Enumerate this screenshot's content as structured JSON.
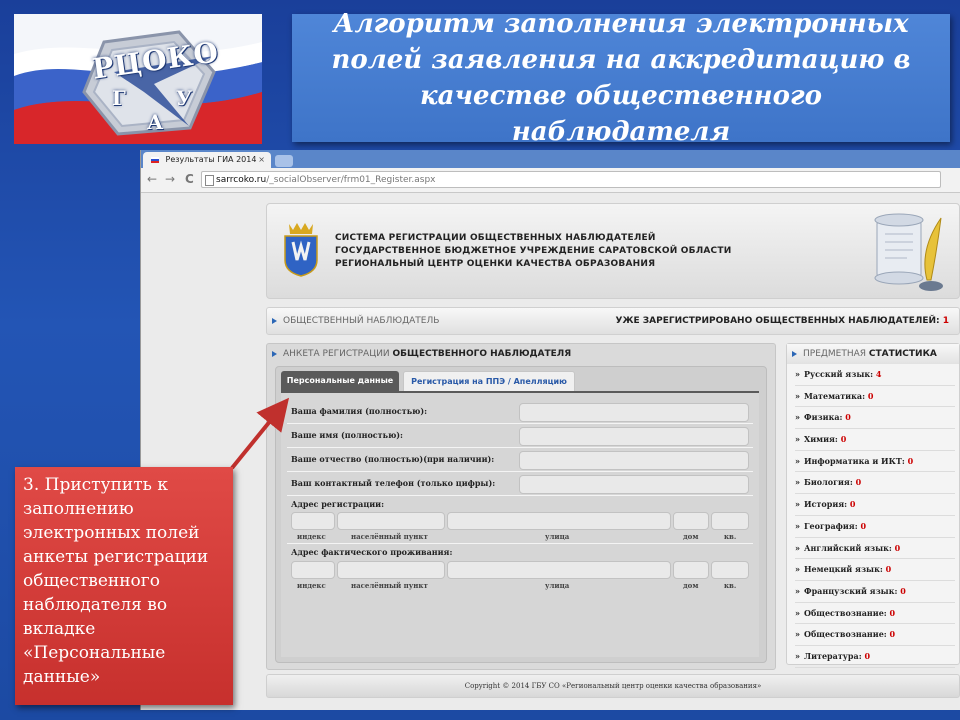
{
  "logo": {
    "main_text": "РЦОКО",
    "letters": [
      "Г",
      "У",
      "А"
    ]
  },
  "slide_title": "Алгоритм заполнения электронных полей заявления на аккредитацию в качестве общественного наблюдателя",
  "browser": {
    "tab_title": "Результаты ГИА 2014",
    "tab_close": "×",
    "url_host": "sarrcoko.ru",
    "url_path": "/_socialObserver/frm01_Register.aspx",
    "nav": {
      "back": "←",
      "forward": "→",
      "reload": "C"
    }
  },
  "site": {
    "header_lines": [
      "СИСТЕМА РЕГИСТРАЦИИ ОБЩЕСТВЕННЫХ НАБЛЮДАТЕЛЕЙ",
      "ГОСУДАРСТВЕННОЕ БЮДЖЕТНОЕ УЧРЕЖДЕНИЕ САРАТОВСКОЙ ОБЛАСТИ",
      "РЕГИОНАЛЬНЫЙ ЦЕНТР ОЦЕНКИ КАЧЕСТВА ОБРАЗОВАНИЯ"
    ],
    "bar_left": "ОБЩЕСТВЕННЫЙ НАБЛЮДАТЕЛЬ",
    "bar_right": "УЖЕ ЗАРЕГИСТРИРОВАНО ОБЩЕСТВЕННЫХ НАБЛЮДАТЕЛЕЙ:",
    "bar_count": "1",
    "form_title_a": "АНКЕТА РЕГИСТРАЦИИ ",
    "form_title_b": "ОБЩЕСТВЕННОГО НАБЛЮДАТЕЛЯ",
    "tabs": [
      {
        "label": "Персональные данные",
        "active": true
      },
      {
        "label": "Регистрация на ППЭ / Апелляцию",
        "active": false
      }
    ],
    "fields": [
      {
        "label": "Ваша фамилия (полностью):",
        "value": ""
      },
      {
        "label": "Ваше имя (полностью):",
        "value": ""
      },
      {
        "label": "Ваше отчество (полностью)(при наличии):",
        "value": ""
      },
      {
        "label": "Ваш контактный телефон (только цифры):",
        "value": ""
      }
    ],
    "address_reg_label": "Адрес регистрации:",
    "address_fact_label": "Адрес фактического проживания:",
    "address_parts": [
      "индекс",
      "населённый пункт",
      "улица",
      "дом",
      "кв."
    ],
    "stats_title_a": "ПРЕДМЕТНАЯ ",
    "stats_title_b": "СТАТИСТИКА",
    "bullet": "»",
    "stats": [
      {
        "subject": "Русский язык:",
        "count": "4"
      },
      {
        "subject": "Математика:",
        "count": "0"
      },
      {
        "subject": "Физика:",
        "count": "0"
      },
      {
        "subject": "Химия:",
        "count": "0"
      },
      {
        "subject": "Информатика и ИКТ:",
        "count": "0"
      },
      {
        "subject": "Биология:",
        "count": "0"
      },
      {
        "subject": "История:",
        "count": "0"
      },
      {
        "subject": "География:",
        "count": "0"
      },
      {
        "subject": "Английский язык:",
        "count": "0"
      },
      {
        "subject": "Немецкий язык:",
        "count": "0"
      },
      {
        "subject": "Французский язык:",
        "count": "0"
      },
      {
        "subject": "Обществознание:",
        "count": "0"
      },
      {
        "subject": "Обществознание:",
        "count": "0"
      },
      {
        "subject": "Литература:",
        "count": "0"
      }
    ],
    "footer": "Copyright © 2014 ГБУ СО «Региональный центр оценки качества образования»"
  },
  "callout_text": "3. Приступить к заполнению электронных полей анкеты регистрации общественного наблюдателя во вкладке «Персональные данные»",
  "colors": {
    "slide_bg": "#2355b5",
    "title_box": "#4a7fd2",
    "callout": "#d63c39",
    "arrow": "#c0302d",
    "count_red": "#cc0000",
    "active_tab": "#5a5a5a"
  }
}
